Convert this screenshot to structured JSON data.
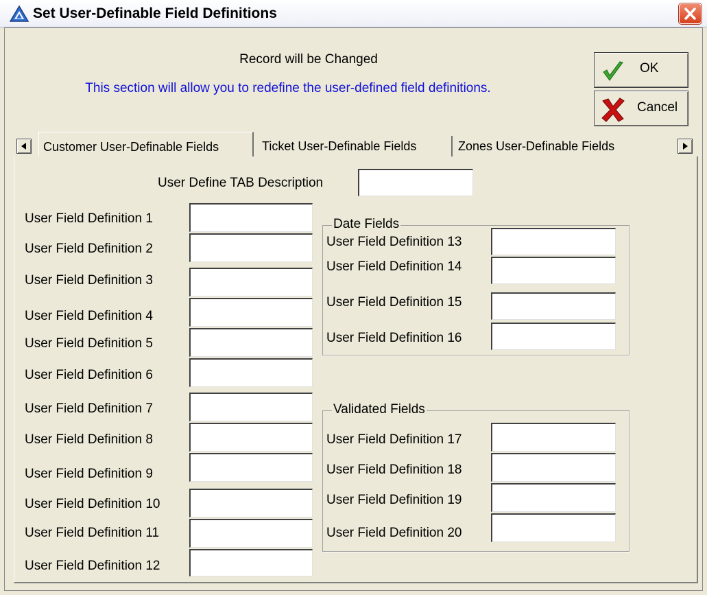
{
  "window": {
    "title": "Set User-Definable Field Definitions",
    "close_symbol": "✕"
  },
  "header": {
    "status_text": "Record will be Changed",
    "info_text": "This section will allow you to redefine the user-defined field definitions."
  },
  "buttons": {
    "ok_label": "OK",
    "cancel_label": "Cancel"
  },
  "tabs": [
    {
      "label": "Customer User-Definable Fields",
      "active": true
    },
    {
      "label": "Ticket User-Definable Fields",
      "active": false
    },
    {
      "label": "Zones User-Definable Fields",
      "active": false
    }
  ],
  "tab_scroll": {
    "left_symbol": "◀",
    "right_symbol": "▶"
  },
  "form": {
    "tab_description": {
      "label": "User Define TAB Description",
      "value": ""
    },
    "left_fields": [
      {
        "label": "User Field Definition 1",
        "value": ""
      },
      {
        "label": "User Field Definition 2",
        "value": ""
      },
      {
        "label": "User Field Definition 3",
        "value": ""
      },
      {
        "label": "User Field Definition 4",
        "value": ""
      },
      {
        "label": "User Field Definition 5",
        "value": ""
      },
      {
        "label": "User Field Definition 6",
        "value": ""
      },
      {
        "label": "User Field Definition 7",
        "value": ""
      },
      {
        "label": "User Field Definition 8",
        "value": ""
      },
      {
        "label": "User Field Definition 9",
        "value": ""
      },
      {
        "label": "User Field Definition 10",
        "value": ""
      },
      {
        "label": "User Field Definition 11",
        "value": ""
      },
      {
        "label": "User Field Definition 12",
        "value": ""
      }
    ],
    "date_group": {
      "title": "Date Fields",
      "fields": [
        {
          "label": "User Field Definition 13",
          "value": ""
        },
        {
          "label": "User Field Definition 14",
          "value": ""
        },
        {
          "label": "User Field Definition 15",
          "value": ""
        },
        {
          "label": "User Field Definition 16",
          "value": ""
        }
      ]
    },
    "validated_group": {
      "title": "Validated Fields",
      "fields": [
        {
          "label": "User Field Definition 17",
          "value": ""
        },
        {
          "label": "User Field Definition 18",
          "value": ""
        },
        {
          "label": "User Field Definition 19",
          "value": ""
        },
        {
          "label": "User Field Definition 20",
          "value": ""
        }
      ]
    }
  },
  "colors": {
    "window_bg": "#ECE9D8",
    "info_text": "#1010D8",
    "ok_check": "#3DA62E",
    "cancel_x": "#C81010",
    "close_button": "#D8401C"
  },
  "icons": {
    "app": "triangle-logo-icon",
    "ok": "checkmark-icon",
    "cancel": "red-x-icon",
    "close": "close-icon"
  }
}
